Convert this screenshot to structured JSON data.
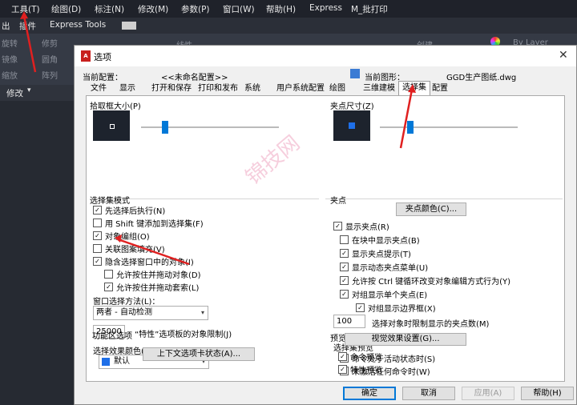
{
  "menubar": [
    "工具(T)",
    "绘图(D)",
    "标注(N)",
    "修改(M)",
    "参数(P)",
    "窗口(W)",
    "帮助(H)",
    "Express",
    "M_批打印"
  ],
  "ribbon": {
    "left1": "出",
    "left2": "插件",
    "tab": "Express Tools"
  },
  "tools": {
    "rotate": "旋转",
    "mirror": "镜像",
    "scale": "缩放",
    "trim": "修剪",
    "fillet": "圆角",
    "array": "阵列",
    "linetype": "线性",
    "create": "创建",
    "rightlabel": "By Layer"
  },
  "modify_bar": "修改",
  "dialog": {
    "title": "选项",
    "current_profile_label": "当前配置：",
    "current_profile_value": "<<未命名配置>>",
    "current_drawing_label": "当前图形：",
    "current_drawing_value": "GGD生产图纸.dwg",
    "tabs": [
      "文件",
      "显示",
      "打开和保存",
      "打印和发布",
      "系统",
      "用户系统配置",
      "绘图",
      "三维建模",
      "选择集",
      "配置"
    ],
    "pickbox": {
      "title": "拾取框大小(P)"
    },
    "selection_modes": {
      "title": "选择集模式",
      "items": [
        "先选择后执行(N)",
        "用 Shift 键添加到选择集(F)",
        "对象编组(O)",
        "关联图案填充(V)",
        "隐含选择窗口中的对象(I)",
        "允许按住并拖动对象(D)",
        "允许按住并拖动套索(L)"
      ],
      "window_method_label": "窗口选择方法(L)：",
      "window_method_value": "两者 - 自动检测",
      "limit_value": "25000",
      "limit_label": "“特性”选项板的对象限制(J)",
      "effect_color_label": "选择效果颜色(E)：",
      "effect_color_value": "默认",
      "effect_color_swatch": "#1e6fe8"
    },
    "ribbon_options": {
      "title": "功能区选项",
      "button": "上下文选项卡状态(A)..."
    },
    "grip_size": {
      "title": "夹点尺寸(Z)"
    },
    "grips": {
      "title": "夹点",
      "color_button": "夹点颜色(C)...",
      "items": [
        "显示夹点(R)",
        "在块中显示夹点(B)",
        "显示夹点提示(T)",
        "显示动态夹点菜单(U)",
        "允许按 Ctrl 键循环改变对象编辑方式行为(Y)",
        "对组显示单个夹点(E)",
        "对组显示边界框(X)"
      ],
      "limit_value": "100",
      "limit_label": "选择对象时限制显示的夹点数(M)"
    },
    "preview": {
      "title": "预览",
      "subtitle": "选择集预览",
      "items": [
        "命令处于活动状态时(S)",
        "未激活任何命令时(W)"
      ],
      "effects_button": "视觉效果设置(G)...",
      "cmd_preview": "命令预览",
      "prop_preview": "特性预览"
    },
    "buttons": {
      "ok": "确定",
      "cancel": "取消",
      "apply": "应用(A)",
      "help": "帮助(H)"
    }
  },
  "watermark": "锦技网",
  "colors": {
    "accent": "#0078d7",
    "arrow": "#e02020"
  }
}
